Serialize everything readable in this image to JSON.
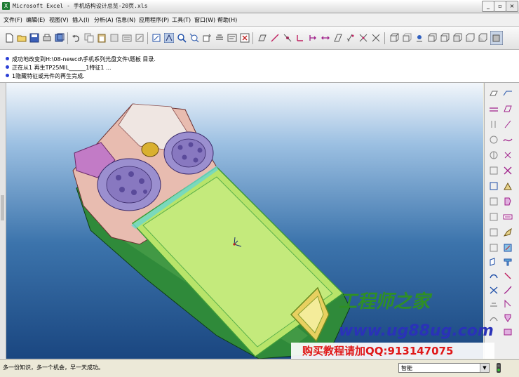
{
  "window": {
    "title": "Microsoft Excel - 手机结构设计总览-20页.xls",
    "minimize": "_",
    "restore": "▫",
    "close": "×"
  },
  "menu": [
    "文件(F)",
    "编辑(E)",
    "视图(V)",
    "插入(I)",
    "分析(A)",
    "信息(N)",
    "应用程序(P)",
    "工具(T)",
    "窗口(W)",
    "帮助(H)"
  ],
  "messages": [
    "成功地改变到H:\\08-newcd\\手机系列光盘文件\\题板 目录.",
    "正在从1 再生TP25MIL______1特征1 ...",
    "1隐藏特征或元件的再生完成."
  ],
  "watermark": {
    "brand": "工程师之家",
    "url": "www.ug88ug.com",
    "promo": "购买教程请加QQ:913147075"
  },
  "status": {
    "text": "多一份知识，多一个机会，早一天成功。",
    "mode": "智能",
    "dropdown_arrow": "▼"
  },
  "colors": {
    "accent_blue": "#2b3fd6",
    "model_bg_top": "#f2f6fb",
    "model_bg_bottom": "#1a4680",
    "lcd_green": "#b8e46a",
    "pcb_green": "#2f8a3a",
    "speaker_purple": "#9b8fcf",
    "brand_green": "#2f8f25",
    "url_blue": "#2a32b8",
    "promo_red": "#e01818"
  },
  "icons": {
    "toolbar": [
      "new-file-icon",
      "open-folder-icon",
      "save-icon",
      "print-icon",
      "save-copy-icon",
      "undo-icon",
      "copy-icon",
      "paste-icon",
      "redo-icon",
      "refresh-icon",
      "repaint-icon",
      "select-icon",
      "zoom-icon",
      "zoom-fit-icon",
      "orient-icon",
      "layers-icon",
      "close-window-icon",
      "datum-plane-icon",
      "datum-axis-icon",
      "datum-point-icon",
      "coordinate-system-icon",
      "dimension-icon",
      "sketch-icon",
      "mirror-icon",
      "spin-icon",
      "shaded-icon",
      "hidden-line-icon",
      "wireframe-icon",
      "no-hidden-icon",
      "display-icon",
      "settings-icon"
    ],
    "sidebar": [
      "datum-plane-icon",
      "datum-axis-icon",
      "datum-curve-icon",
      "datum-point-icon",
      "coordinate-system-icon",
      "sketch-icon",
      "extrude-icon",
      "revolve-icon",
      "hole-icon",
      "shell-icon",
      "rib-icon",
      "draft-icon",
      "round-icon",
      "chamfer-icon",
      "cut-icon",
      "pattern-icon",
      "mirror-icon",
      "merge-icon",
      "trim-icon",
      "offset-icon",
      "thicken-icon",
      "solidify-icon"
    ]
  }
}
